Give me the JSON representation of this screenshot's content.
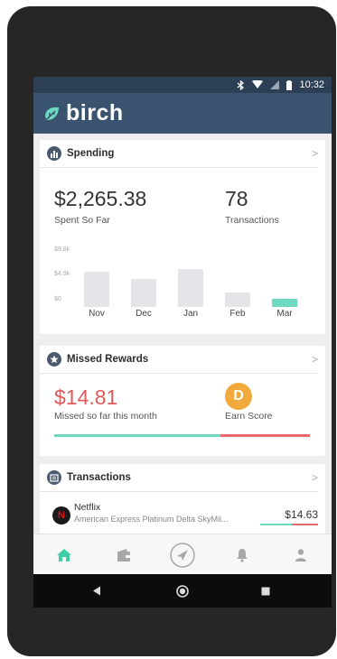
{
  "status_bar": {
    "time": "10:32"
  },
  "app": {
    "name": "birch"
  },
  "spending": {
    "title": "Spending",
    "spent_value": "$2,265.38",
    "spent_label": "Spent So Far",
    "tx_count": "78",
    "tx_label": "Transactions",
    "y_ticks": [
      "$9.8k",
      "$4.9k",
      "$0"
    ]
  },
  "chart_data": {
    "type": "bar",
    "categories": [
      "Nov",
      "Dec",
      "Jan",
      "Feb",
      "Mar"
    ],
    "values": [
      6.0,
      4.8,
      6.4,
      2.4,
      1.4
    ],
    "ylim": [
      0,
      9.8
    ],
    "ylabel": "",
    "xlabel": "",
    "highlight": "Mar",
    "bar_color": "#e3e5e9",
    "highlight_color": "#6ed9c1"
  },
  "missed_rewards": {
    "title": "Missed Rewards",
    "amount": "$14.81",
    "amount_label": "Missed so far this month",
    "score_letter": "D",
    "score_label": "Earn Score",
    "progress_fraction": 0.65,
    "colors": {
      "good": "#6ed9c1",
      "bad": "#e66a6a",
      "missed": "#e05a5a",
      "score": "#f0a93a"
    }
  },
  "transactions": {
    "title": "Transactions",
    "items": [
      {
        "merchant": "Netflix",
        "card": "American Express Platinum Delta SkyMil...",
        "amount": "$14.63",
        "logo_letter": "N",
        "reward_fraction": 0.55
      }
    ]
  },
  "bottom_nav": {
    "items": [
      {
        "icon": "home-icon",
        "active": true
      },
      {
        "icon": "wallet-icon",
        "active": false
      },
      {
        "icon": "navigation-icon",
        "active": false
      },
      {
        "icon": "bell-icon",
        "active": false
      },
      {
        "icon": "profile-icon",
        "active": false
      }
    ],
    "accent": "#3ecfa8"
  },
  "theme": {
    "header": "#3a5470",
    "status_bar": "#2c3f55"
  }
}
